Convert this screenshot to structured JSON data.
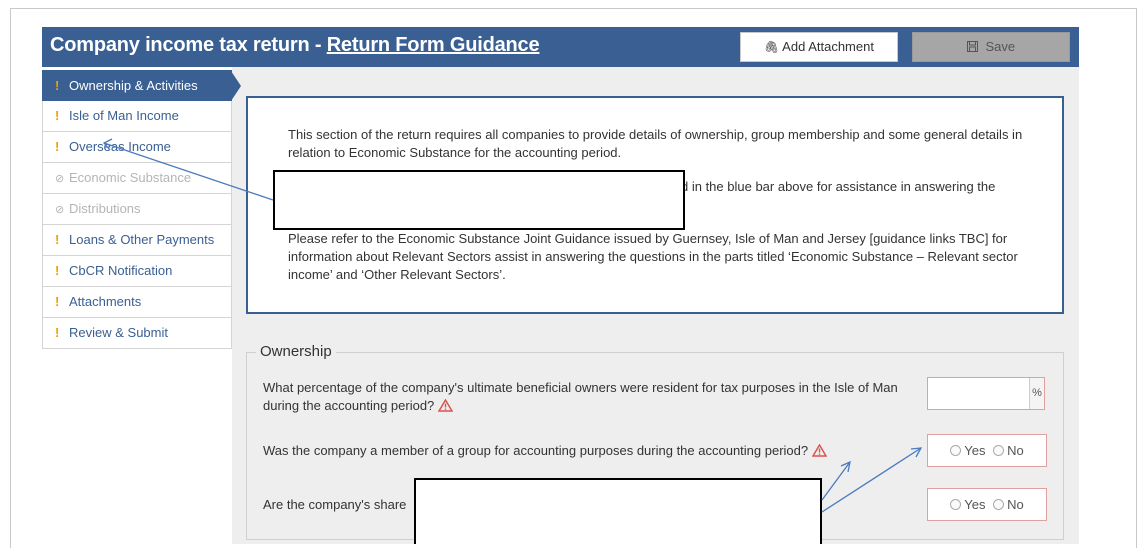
{
  "header": {
    "title_prefix": "Company income tax return - ",
    "title_link": "Return Form Guidance",
    "add_attachment_label": "Add Attachment",
    "save_label": "Save"
  },
  "sidebar": {
    "items": [
      {
        "label": "Ownership & Activities",
        "state": "active",
        "marker": "!"
      },
      {
        "label": "Isle of Man Income",
        "state": "normal",
        "marker": "!"
      },
      {
        "label": "Overseas Income",
        "state": "normal",
        "marker": "!"
      },
      {
        "label": "Economic Substance",
        "state": "disabled",
        "marker": "⊘"
      },
      {
        "label": "Distributions",
        "state": "disabled",
        "marker": "⊘"
      },
      {
        "label": "Loans & Other Payments",
        "state": "normal",
        "marker": "!"
      },
      {
        "label": "CbCR Notification",
        "state": "normal",
        "marker": "!"
      },
      {
        "label": "Attachments",
        "state": "normal",
        "marker": "!"
      },
      {
        "label": "Review & Submit",
        "state": "normal",
        "marker": "!"
      }
    ]
  },
  "info": {
    "para1": "This section of the return requires all companies to provide details of ownership, group membership and some general details in relation to Economic Substance for the accounting period.",
    "para2_visible": "d in the blue bar above for assistance in answering the",
    "para3": "Please refer to the Economic Substance Joint Guidance issued by Guernsey, Isle of Man and Jersey [guidance links TBC] for information about Relevant Sectors assist in answering the questions in the parts titled ‘Economic Substance – Relevant sector income’ and ‘Other Relevant Sectors’."
  },
  "ownership": {
    "legend": "Ownership",
    "q1": "What percentage of the company's ultimate beneficial owners were resident for tax purposes in the Isle of Man during the accounting period?",
    "q1_value": "",
    "q1_addon": "%",
    "q2": "Was the company a member of a group for accounting purposes during the accounting period?",
    "q3_visible": "Are the company's share",
    "yes_label": "Yes",
    "no_label": "No"
  },
  "colors": {
    "header_blue": "#3a5f92",
    "warning_orange": "#f0a000",
    "error_red": "#d9534f"
  }
}
